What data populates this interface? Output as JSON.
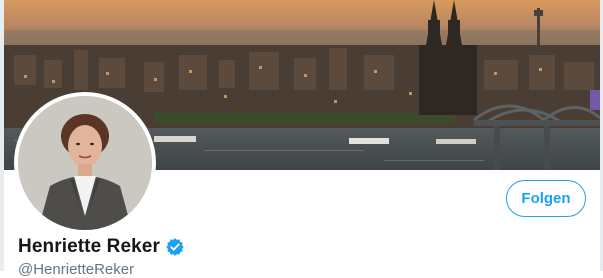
{
  "profile": {
    "display_name": "Henriette Reker",
    "handle": "@HenrietteReker",
    "verified": true
  },
  "actions": {
    "follow_label": "Folgen"
  },
  "banner": {
    "subject": "city-skyline-photo"
  },
  "colors": {
    "accent": "#1da1f2",
    "name_text": "#14171a",
    "handle_text": "#657786",
    "background": "#ffffff"
  }
}
